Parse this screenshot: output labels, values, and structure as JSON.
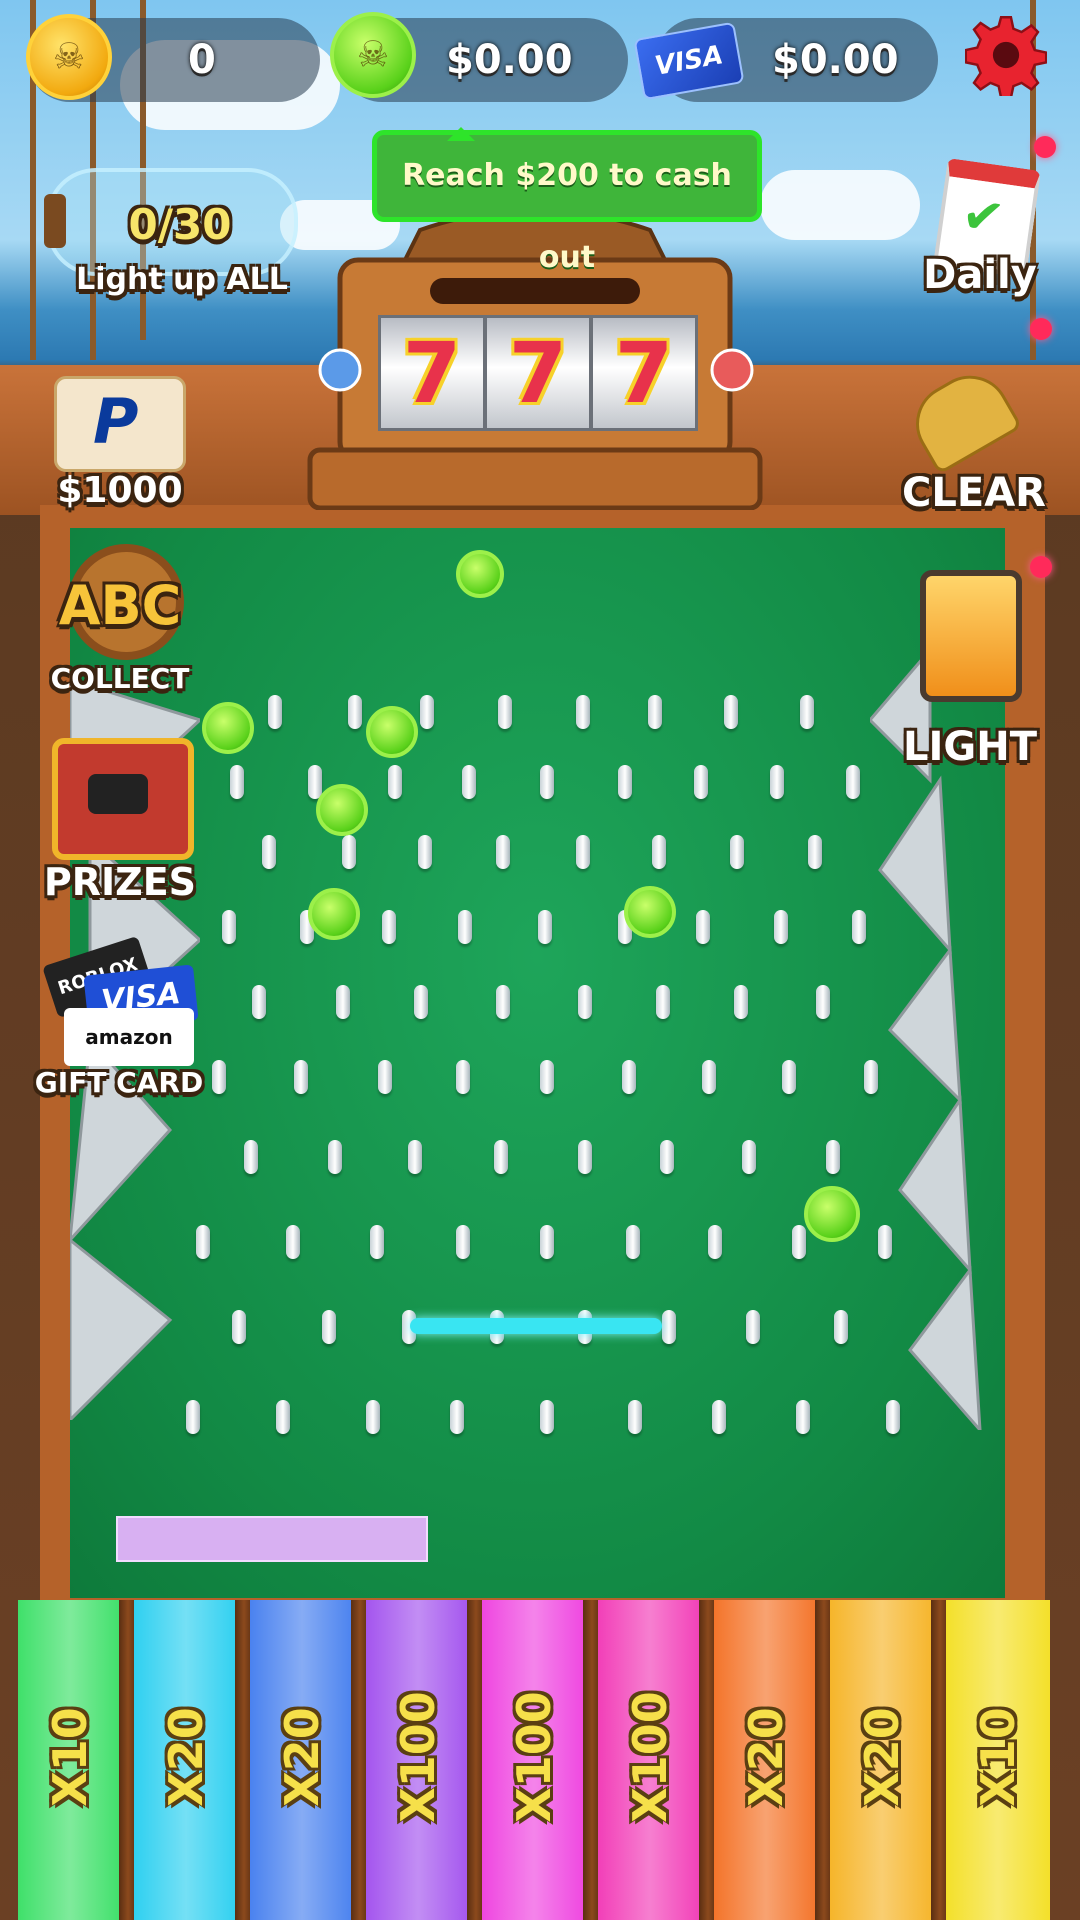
{
  "hud": {
    "gold_coins": "0",
    "green_cash": "$0.00",
    "card_cash": "$0.00",
    "card_brand": "VISA"
  },
  "tooltip": "Reach $200 to cash out",
  "progress": {
    "counter": "0/30",
    "caption": "Light up ALL",
    "fraction": 0.0
  },
  "left_menu": {
    "paypal_label": "$1000",
    "abc_badge": "ABC",
    "collect_label": "COLLECT",
    "prizes_label": "PRIZES",
    "giftcard_label": "GIFT CARD",
    "giftcard_brands": [
      "ROBLOX",
      "VISA",
      "amazon"
    ]
  },
  "right_menu": {
    "daily_label": "Daily",
    "clear_label": "CLEAR",
    "light_label": "LIGHT"
  },
  "slot_machine": {
    "reels": [
      "7",
      "7",
      "7"
    ]
  },
  "multipliers": [
    "X10",
    "X20",
    "X20",
    "X100",
    "X100",
    "X100",
    "X20",
    "X20",
    "X10"
  ],
  "colors": {
    "felt": "#128a45",
    "bumper": "#39e5f2",
    "slots": [
      "#3fe06a",
      "#2fd0f0",
      "#4a82ef",
      "#a455ee",
      "#ef46e0",
      "#f23fb8",
      "#f4742a",
      "#f6b52a",
      "#f4e02a"
    ]
  },
  "icons": [
    "gold-skull-coin-icon",
    "green-skull-coin-icon",
    "visa-card-icon",
    "gear-icon",
    "bottle-icon",
    "paypal-icon",
    "ship-wheel-icon",
    "treasure-chest-icon",
    "calendar-check-icon",
    "broom-icon",
    "lantern-icon"
  ]
}
